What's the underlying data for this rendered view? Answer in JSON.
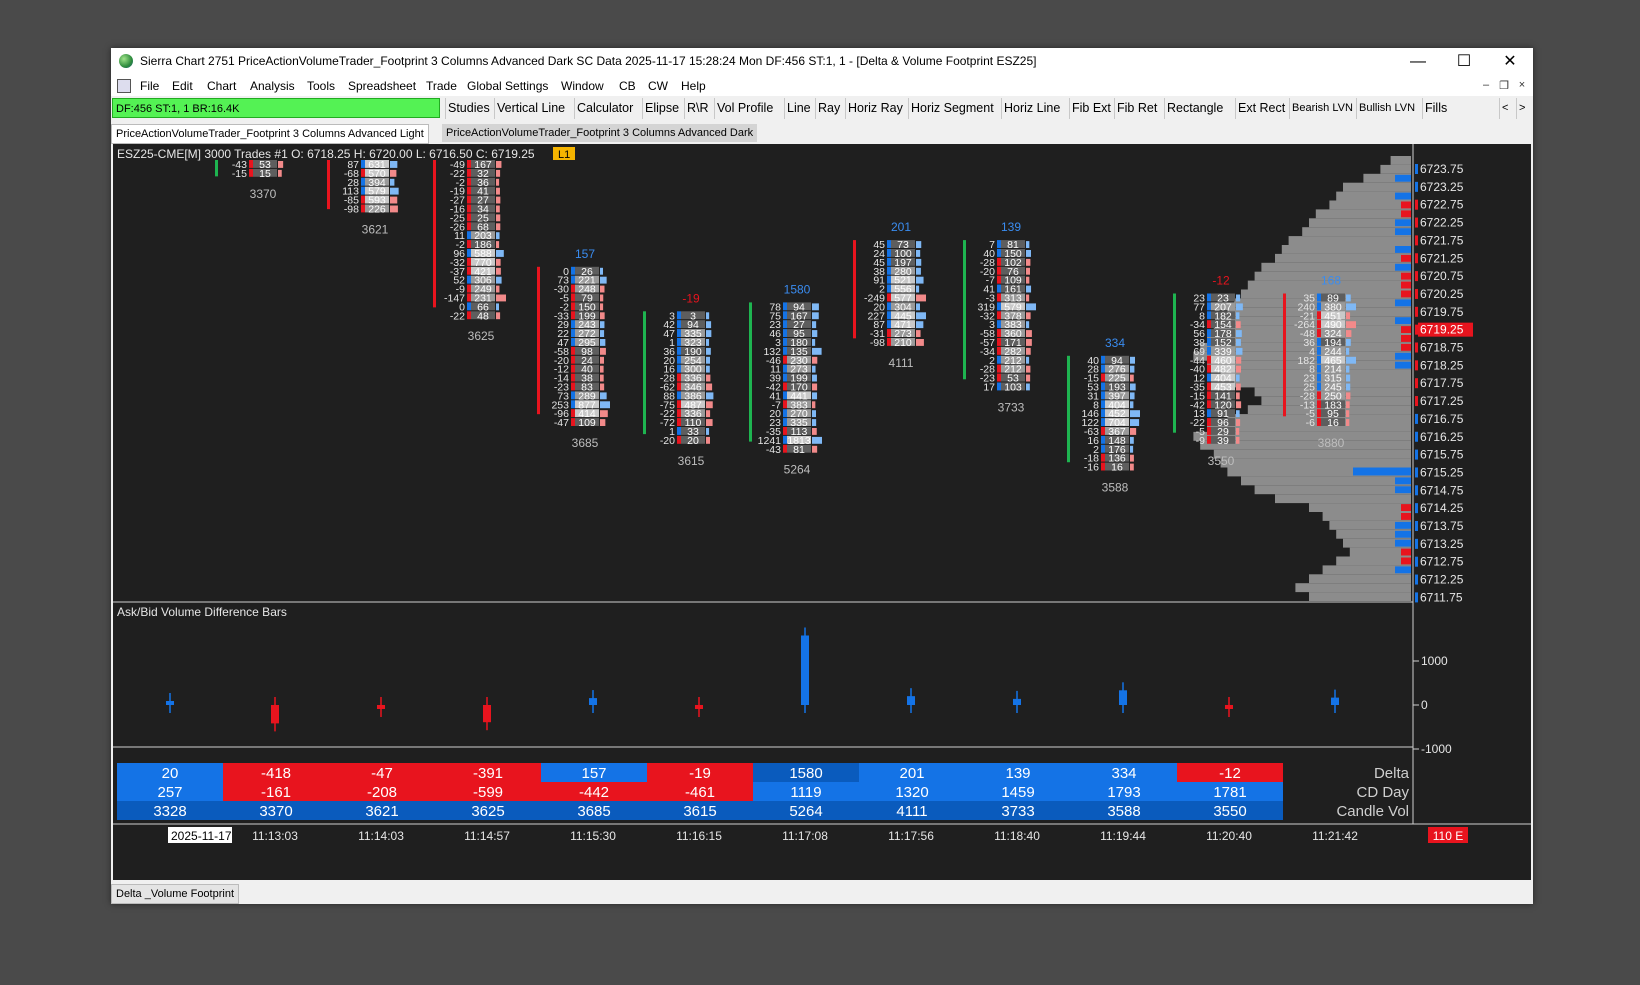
{
  "window": {
    "title": "Sierra Chart 2751 PriceActionVolumeTrader_Footprint 3 Columns Advanced Dark SC Data 2025-11-17  15:28:24 Mon DF:456  ST:1, 1 - [Delta & Volume Footprint ESZ25]",
    "min_glyph": "—",
    "max_glyph": "☐",
    "close_glyph": "✕"
  },
  "menu": [
    "File",
    "Edit",
    "Chart",
    "Analysis",
    "Tools",
    "Spreadsheet",
    "Trade",
    "Global Settings",
    "Window",
    "CB",
    "CW",
    "Help"
  ],
  "mdi": {
    "min": "–",
    "restore": "❐",
    "close": "×"
  },
  "toolbar": {
    "status": "DF:456  ST:1, 1   BR:16.4K",
    "buttons": [
      "Studies",
      "Vertical Line",
      "Calculator",
      "Elipse",
      "R\\R",
      "Vol Profile",
      "Line",
      "Ray",
      "Horiz Ray",
      "Horiz Segment",
      "Horiz Line",
      "Fib Ext",
      "Fib Ret",
      "Rectangle",
      "Ext Rect",
      "Bearish LVN",
      "Bullish LVN",
      "Fills"
    ],
    "scroll_left": "<",
    "scroll_right": ">"
  },
  "tabs": [
    "PriceActionVolumeTrader_Footprint 3 Columns Advanced Light",
    "PriceActionVolumeTrader_Footprint 3 Columns Advanced Dark"
  ],
  "bottom_tab": "Delta _Volume Footprint",
  "chart": {
    "header": "ESZ25-CME[M]  3000 Trades #1 O: 6718.25 H: 6720.00 L: 6716.50 C: 6719.25",
    "badge": "L1",
    "subgraph_title": "Ask/Bid Volume Difference Bars",
    "current_price": "6719.25",
    "bottom_right_badge": "110 E",
    "date_label": "2025-11-17",
    "price_ticks": [
      "6723.75",
      "6723.25",
      "6722.75",
      "6722.25",
      "6721.75",
      "6721.25",
      "6720.75",
      "6720.25",
      "6719.75",
      "6719.25",
      "6718.75",
      "6718.25",
      "6717.75",
      "6717.25",
      "6716.75",
      "6716.25",
      "6715.75",
      "6715.25",
      "6714.75",
      "6714.25",
      "6713.75",
      "6713.25",
      "6712.75",
      "6712.25",
      "6711.75"
    ],
    "diff_ticks": [
      "1000",
      "0",
      "-1000"
    ],
    "time_labels": [
      "11:13:03",
      "11:14:03",
      "11:14:57",
      "11:15:30",
      "11:16:15",
      "11:17:08",
      "11:17:56",
      "11:18:40",
      "11:19:44",
      "11:20:40",
      "11:21:42"
    ],
    "table_row_labels": [
      "Delta",
      "CD Day",
      "Candle Vol"
    ],
    "table": [
      {
        "delta": "20",
        "cd": "257",
        "vol": "3328"
      },
      {
        "delta": "-418",
        "cd": "-161",
        "vol": "3370"
      },
      {
        "delta": "-47",
        "cd": "-208",
        "vol": "3621"
      },
      {
        "delta": "-391",
        "cd": "-599",
        "vol": "3625"
      },
      {
        "delta": "157",
        "cd": "-442",
        "vol": "3685"
      },
      {
        "delta": "-19",
        "cd": "-461",
        "vol": "3615"
      },
      {
        "delta": "1580",
        "cd": "1119",
        "vol": "5264"
      },
      {
        "delta": "201",
        "cd": "1320",
        "vol": "4111"
      },
      {
        "delta": "139",
        "cd": "1459",
        "vol": "3733"
      },
      {
        "delta": "334",
        "cd": "1793",
        "vol": "3588"
      },
      {
        "delta": "-12",
        "cd": "1781",
        "vol": "3550"
      }
    ],
    "bars": [
      {
        "delta": "",
        "volume": "3370",
        "high": 6723.75,
        "low": 6723.5,
        "rows": [
          [
            "-43",
            "53"
          ],
          [
            "-15",
            "15"
          ]
        ]
      },
      {
        "delta": "",
        "volume": "3621",
        "high": 6723.75,
        "low": 6722.25,
        "rows": [
          [
            "87",
            "631"
          ],
          [
            "-68",
            "570"
          ],
          [
            "28",
            "394"
          ],
          [
            "113",
            "579"
          ],
          [
            "-85",
            "593"
          ],
          [
            "-98",
            "226"
          ]
        ]
      },
      {
        "delta": "",
        "volume": "3625",
        "high": 6723.75,
        "low": 6720.0,
        "rows": [
          [
            "-49",
            "167"
          ],
          [
            "-22",
            "32"
          ],
          [
            "-2",
            "36"
          ],
          [
            "-19",
            "41"
          ],
          [
            "-27",
            "27"
          ],
          [
            "-16",
            "34"
          ],
          [
            "-25",
            "25"
          ],
          [
            "-26",
            "68"
          ],
          [
            "11",
            "203"
          ],
          [
            "-2",
            "186"
          ],
          [
            "96",
            "588"
          ],
          [
            "-32",
            "770"
          ],
          [
            "-37",
            "421"
          ],
          [
            "52",
            "306"
          ],
          [
            "-9",
            "249"
          ],
          [
            "-147",
            "231"
          ],
          [
            "0",
            "66"
          ],
          [
            "-22",
            "48"
          ]
        ]
      },
      {
        "delta": "157",
        "volume": "3685",
        "high": 6720.75,
        "low": 6716.75,
        "rows": [
          [
            "0",
            "26"
          ],
          [
            "73",
            "221"
          ],
          [
            "-30",
            "248"
          ],
          [
            "-5",
            "79"
          ],
          [
            "-2",
            "150"
          ],
          [
            "-33",
            "199"
          ],
          [
            "29",
            "243"
          ],
          [
            "22",
            "272"
          ],
          [
            "47",
            "295"
          ],
          [
            "-58",
            "98"
          ],
          [
            "-20",
            "24"
          ],
          [
            "-12",
            "40"
          ],
          [
            "-14",
            "38"
          ],
          [
            "-23",
            "83"
          ],
          [
            "73",
            "289"
          ],
          [
            "253",
            "877"
          ],
          [
            "-96",
            "414"
          ],
          [
            "-47",
            "109"
          ]
        ]
      },
      {
        "delta": "-19",
        "volume": "3615",
        "high": 6719.5,
        "low": 6715.5,
        "rows": [
          [
            "3",
            "3"
          ],
          [
            "42",
            "94"
          ],
          [
            "47",
            "335"
          ],
          [
            "1",
            "323"
          ],
          [
            "36",
            "190"
          ],
          [
            "20",
            "254"
          ],
          [
            "16",
            "300"
          ],
          [
            "-28",
            "336"
          ],
          [
            "-62",
            "346"
          ],
          [
            "88",
            "386"
          ],
          [
            "-75",
            "487"
          ],
          [
            "-22",
            "336"
          ],
          [
            "-72",
            "110"
          ],
          [
            "1",
            "33"
          ],
          [
            "-20",
            "20"
          ]
        ]
      },
      {
        "delta": "1580",
        "volume": "5264",
        "high": 6719.75,
        "low": 6715.0,
        "rows": [
          [
            "78",
            "94"
          ],
          [
            "75",
            "167"
          ],
          [
            "23",
            "27"
          ],
          [
            "46",
            "95"
          ],
          [
            "3",
            "180"
          ],
          [
            "132",
            "135"
          ],
          [
            "-46",
            "230"
          ],
          [
            "11",
            "273"
          ],
          [
            "39",
            "199"
          ],
          [
            "-42",
            "170"
          ],
          [
            "41",
            "441"
          ],
          [
            "-7",
            "383"
          ],
          [
            "20",
            "270"
          ],
          [
            "23",
            "335"
          ],
          [
            "-35",
            "113"
          ],
          [
            "1241",
            "1813"
          ],
          [
            "-43",
            "81"
          ]
        ]
      },
      {
        "delta": "201",
        "volume": "4111",
        "high": 6721.5,
        "low": 6718.75,
        "rows": [
          [
            "45",
            "73"
          ],
          [
            "24",
            "100"
          ],
          [
            "45",
            "197"
          ],
          [
            "38",
            "280"
          ],
          [
            "91",
            "521"
          ],
          [
            "2",
            "556"
          ],
          [
            "-249",
            "577"
          ],
          [
            "20",
            "304"
          ],
          [
            "227",
            "445"
          ],
          [
            "87",
            "471"
          ],
          [
            "-31",
            "273"
          ],
          [
            "-98",
            "210"
          ]
        ]
      },
      {
        "delta": "139",
        "volume": "3733",
        "high": 6721.5,
        "low": 6717.25,
        "rows": [
          [
            "7",
            "81"
          ],
          [
            "40",
            "150"
          ],
          [
            "-28",
            "102"
          ],
          [
            "-20",
            "76"
          ],
          [
            "-7",
            "109"
          ],
          [
            "41",
            "161"
          ],
          [
            "-3",
            "313"
          ],
          [
            "319",
            "579"
          ],
          [
            "-32",
            "378"
          ],
          [
            "3",
            "383"
          ],
          [
            "-58",
            "360"
          ],
          [
            "-57",
            "171"
          ],
          [
            "-34",
            "282"
          ],
          [
            "2",
            "212"
          ],
          [
            "-28",
            "212"
          ],
          [
            "-23",
            "53"
          ],
          [
            "17",
            "103"
          ]
        ]
      },
      {
        "delta": "334",
        "volume": "3588",
        "high": 6718.25,
        "low": 6715.25,
        "rows": [
          [
            "40",
            "94"
          ],
          [
            "28",
            "276"
          ],
          [
            "-15",
            "225"
          ],
          [
            "53",
            "193"
          ],
          [
            "31",
            "397"
          ],
          [
            "8",
            "404"
          ],
          [
            "146",
            "452"
          ],
          [
            "122",
            "704"
          ],
          [
            "-63",
            "367"
          ],
          [
            "16",
            "148"
          ],
          [
            "2",
            "176"
          ],
          [
            "-18",
            "136"
          ],
          [
            "-16",
            "16"
          ]
        ]
      },
      {
        "delta": "-12",
        "volume": "3550",
        "high": 6720.0,
        "low": 6716.0,
        "rows": [
          [
            "23",
            "23"
          ],
          [
            "77",
            "207"
          ],
          [
            "8",
            "182"
          ],
          [
            "-34",
            "154"
          ],
          [
            "56",
            "178"
          ],
          [
            "38",
            "152"
          ],
          [
            "69",
            "339"
          ],
          [
            "-44",
            "460"
          ],
          [
            "-40",
            "482"
          ],
          [
            "12",
            "404"
          ],
          [
            "-35",
            "453"
          ],
          [
            "-15",
            "141"
          ],
          [
            "-42",
            "120"
          ],
          [
            "13",
            "91"
          ],
          [
            "-22",
            "96"
          ],
          [
            "-5",
            "29"
          ],
          [
            "-9",
            "39"
          ]
        ]
      },
      {
        "delta": "168",
        "volume": "3880",
        "high": 6720.0,
        "low": 6716.5,
        "rows": [
          [
            "35",
            "89"
          ],
          [
            "240",
            "380"
          ],
          [
            "-21",
            "451"
          ],
          [
            "-264",
            "490"
          ],
          [
            "-48",
            "324"
          ],
          [
            "36",
            "194"
          ],
          [
            "4",
            "244"
          ],
          [
            "182",
            "465"
          ],
          [
            "8",
            "214"
          ],
          [
            "23",
            "315"
          ],
          [
            "25",
            "245"
          ],
          [
            "-28",
            "250"
          ],
          [
            "-13",
            "183"
          ],
          [
            "-5",
            "95"
          ],
          [
            "-6",
            "16"
          ]
        ]
      }
    ],
    "diff_bars": [
      20,
      -418,
      -47,
      -391,
      157,
      -19,
      1580,
      201,
      139,
      334,
      -12,
      168
    ],
    "colors": {
      "up": "#1473e6",
      "down": "#e8141e",
      "green": "#1eb450",
      "accent": "#f5b400"
    }
  }
}
